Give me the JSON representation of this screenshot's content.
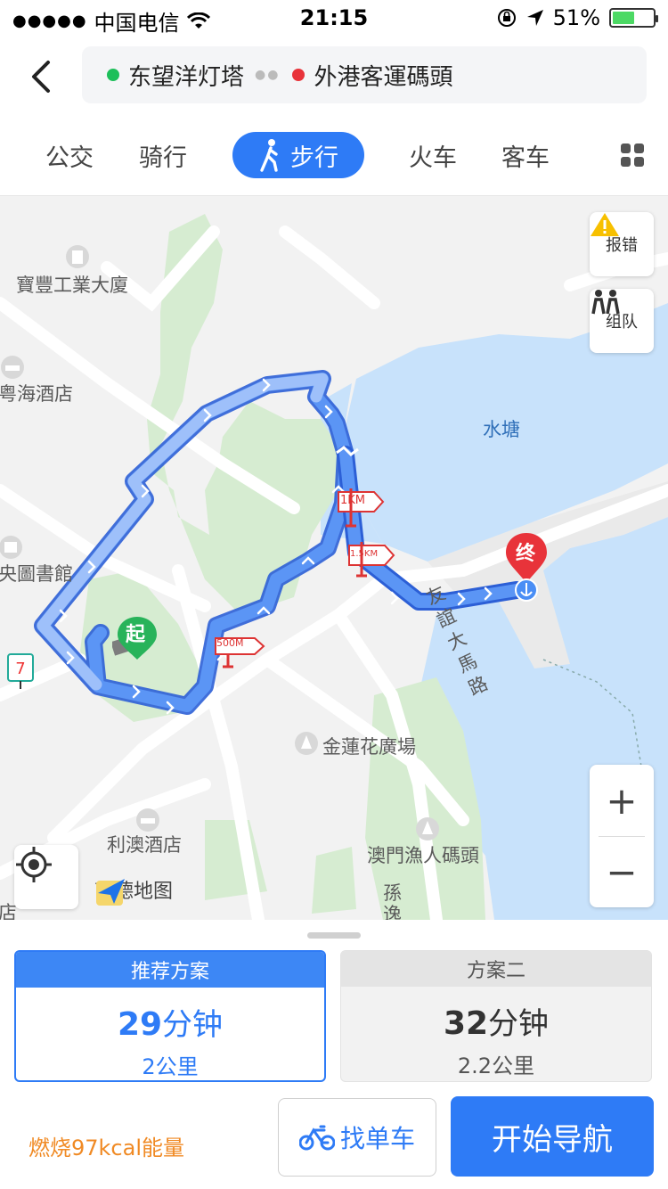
{
  "status_bar": {
    "carrier": "中国电信",
    "time": "21:15",
    "battery": "51%",
    "battery_level": 0.51
  },
  "route": {
    "start": "东望洋灯塔",
    "end": "外港客運碼頭",
    "start_color": "#1dbf5a",
    "end_color": "#e8333a"
  },
  "tabs": [
    {
      "label": "公交",
      "active": false
    },
    {
      "label": "骑行",
      "active": false
    },
    {
      "label": "步行",
      "active": true
    },
    {
      "label": "火车",
      "active": false
    },
    {
      "label": "客车",
      "active": false
    }
  ],
  "map": {
    "labels": {
      "building": "寶豐工業大廈",
      "hotel_left": "粤海酒店",
      "library": "央圖書館",
      "water": "水塘",
      "road": "友誼大馬路",
      "plaza": "金蓮花廣場",
      "hotel_bottom": "利澳酒店",
      "pier": "澳門漁人碼頭",
      "road2": "孫逸",
      "edge_left": "店"
    },
    "markers": {
      "start": "起",
      "end": "终"
    },
    "distance_signs": [
      "500M",
      "1KM",
      "1.5KM"
    ],
    "buttons": {
      "report": "报错",
      "group": "组队",
      "zoom_in": "+",
      "zoom_out": "−"
    },
    "logo": "高德地图",
    "route_color": "#3d7ff5"
  },
  "plans": {
    "recommended": {
      "title": "推荐方案",
      "duration_value": "29",
      "duration_unit": "分钟",
      "distance": "2公里"
    },
    "second": {
      "title": "方案二",
      "duration_value": "32",
      "duration_unit": "分钟",
      "distance": "2.2公里"
    }
  },
  "footer": {
    "calories": "燃烧97kcal能量",
    "bike_button": "找单车",
    "navigate_button": "开始导航"
  }
}
